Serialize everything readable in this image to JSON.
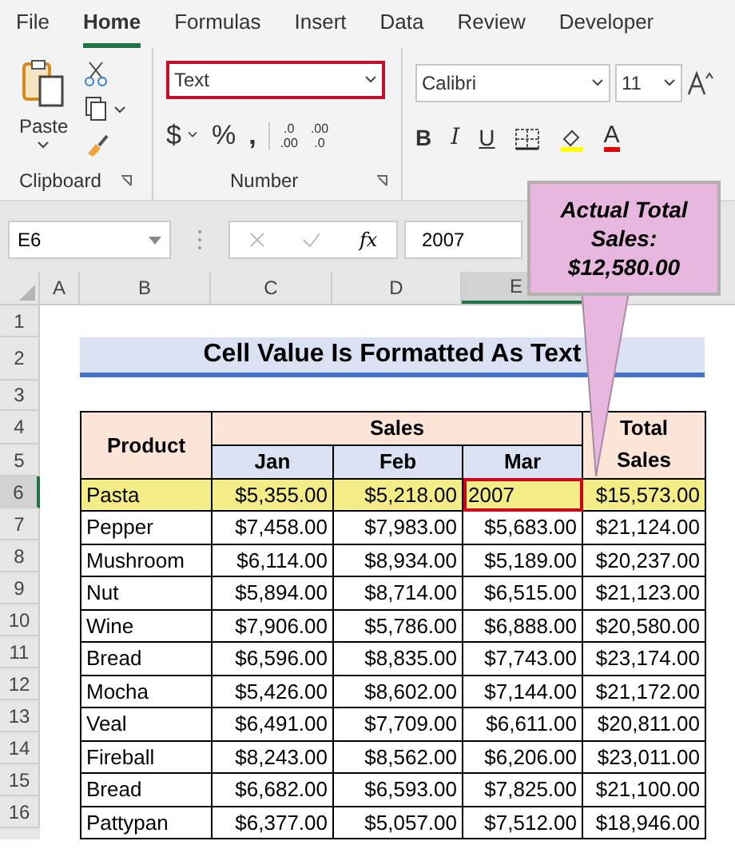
{
  "tabs": [
    {
      "label": "File",
      "selected": false
    },
    {
      "label": "Home",
      "selected": true
    },
    {
      "label": "Formulas",
      "selected": false
    },
    {
      "label": "Insert",
      "selected": false
    },
    {
      "label": "Data",
      "selected": false
    },
    {
      "label": "Review",
      "selected": false
    },
    {
      "label": "Developer",
      "selected": false
    }
  ],
  "ribbon": {
    "clipboard": {
      "paste": "Paste",
      "label": "Clipboard"
    },
    "number": {
      "format": "Text",
      "format_highlighted": true,
      "currency": "$",
      "percent": "%",
      "comma": ",",
      "increase_decimal": [
        ".0",
        ".00"
      ],
      "decrease_decimal": [
        ".00",
        ".0"
      ],
      "label": "Number"
    },
    "font": {
      "family": "Calibri",
      "size": "11",
      "bold": "B",
      "italic": "I",
      "underline": "U",
      "font_color": "A"
    }
  },
  "formula_bar": {
    "name_box": "E6",
    "fx": "fx",
    "value": "2007"
  },
  "columns": [
    {
      "label": "A",
      "selected": false
    },
    {
      "label": "B",
      "selected": false
    },
    {
      "label": "C",
      "selected": false
    },
    {
      "label": "D",
      "selected": false
    },
    {
      "label": "E",
      "selected": true
    }
  ],
  "row_numbers": [
    {
      "label": "1",
      "selected": false
    },
    {
      "label": "2",
      "selected": false
    },
    {
      "label": "3",
      "selected": false
    },
    {
      "label": "4",
      "selected": false
    },
    {
      "label": "5",
      "selected": false
    },
    {
      "label": "6",
      "selected": true
    },
    {
      "label": "7",
      "selected": false
    },
    {
      "label": "8",
      "selected": false
    },
    {
      "label": "9",
      "selected": false
    },
    {
      "label": "10",
      "selected": false
    },
    {
      "label": "11",
      "selected": false
    },
    {
      "label": "12",
      "selected": false
    },
    {
      "label": "13",
      "selected": false
    },
    {
      "label": "14",
      "selected": false
    },
    {
      "label": "15",
      "selected": false
    },
    {
      "label": "16",
      "selected": false
    }
  ],
  "sheet": {
    "title": "Cell Value Is Formatted As Text",
    "headers": {
      "product": "Product",
      "sales": "Sales",
      "months": [
        "Jan",
        "Feb",
        "Mar"
      ],
      "total": "Total Sales"
    },
    "rows": [
      {
        "product": "Pasta",
        "jan": "$5,355.00",
        "feb": "$5,218.00",
        "mar": "2007",
        "total": "$15,573.00",
        "highlighted": true,
        "mar_selected": true,
        "kind": "text_entry"
      },
      {
        "product": "Pepper",
        "jan": "$7,458.00",
        "feb": "$7,983.00",
        "mar": "$5,683.00",
        "total": "$21,124.00",
        "highlighted": false,
        "mar_selected": false,
        "kind": "number"
      },
      {
        "product": "Mushroom",
        "jan": "$6,114.00",
        "feb": "$8,934.00",
        "mar": "$5,189.00",
        "total": "$20,237.00",
        "highlighted": false,
        "mar_selected": false,
        "kind": "number"
      },
      {
        "product": "Nut",
        "jan": "$5,894.00",
        "feb": "$8,714.00",
        "mar": "$6,515.00",
        "total": "$21,123.00",
        "highlighted": false,
        "mar_selected": false,
        "kind": "number"
      },
      {
        "product": "Wine",
        "jan": "$7,906.00",
        "feb": "$5,786.00",
        "mar": "$6,888.00",
        "total": "$20,580.00",
        "highlighted": false,
        "mar_selected": false,
        "kind": "number"
      },
      {
        "product": "Bread",
        "jan": "$6,596.00",
        "feb": "$8,835.00",
        "mar": "$7,743.00",
        "total": "$23,174.00",
        "highlighted": false,
        "mar_selected": false,
        "kind": "number"
      },
      {
        "product": "Mocha",
        "jan": "$5,426.00",
        "feb": "$8,602.00",
        "mar": "$7,144.00",
        "total": "$21,172.00",
        "highlighted": false,
        "mar_selected": false,
        "kind": "number"
      },
      {
        "product": "Veal",
        "jan": "$6,491.00",
        "feb": "$7,709.00",
        "mar": "$6,611.00",
        "total": "$20,811.00",
        "highlighted": false,
        "mar_selected": false,
        "kind": "number"
      },
      {
        "product": "Fireball",
        "jan": "$8,243.00",
        "feb": "$8,562.00",
        "mar": "$6,206.00",
        "total": "$23,011.00",
        "highlighted": false,
        "mar_selected": false,
        "kind": "number"
      },
      {
        "product": "Bread",
        "jan": "$6,682.00",
        "feb": "$6,593.00",
        "mar": "$7,825.00",
        "total": "$21,100.00",
        "highlighted": false,
        "mar_selected": false,
        "kind": "number"
      },
      {
        "product": "Pattypan",
        "jan": "$6,377.00",
        "feb": "$5,057.00",
        "mar": "$7,512.00",
        "total": "$18,946.00",
        "highlighted": false,
        "mar_selected": false,
        "kind": "number"
      }
    ]
  },
  "callout": {
    "text": "Actual Total Sales: $12,580.00"
  }
}
